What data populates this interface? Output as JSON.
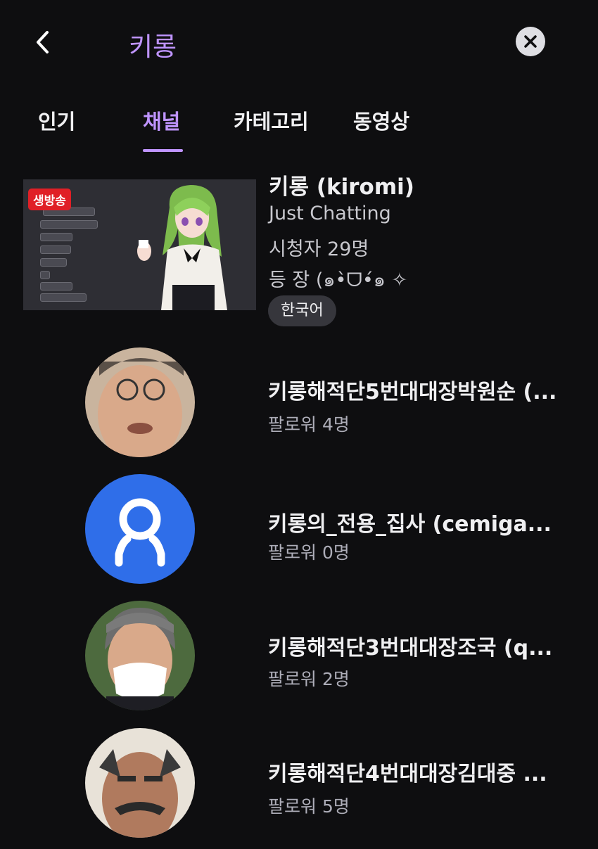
{
  "search": {
    "query": "키롱"
  },
  "tabs": [
    {
      "label": "인기"
    },
    {
      "label": "채널"
    },
    {
      "label": "카테고리"
    },
    {
      "label": "동영상"
    }
  ],
  "live": {
    "badge": "생방송",
    "title": "키롱 (kiromi)",
    "category": "Just Chatting",
    "viewers": "시청자 29명",
    "stream_title": "등 장 (๑•̀ᗜ•́๑ ✧",
    "tag": "한국어"
  },
  "channels": [
    {
      "name": "키롱해적단5번대대장박원순 (...",
      "followers": "팔로워 4명"
    },
    {
      "name": "키롱의_전용_집사 (cemiga...",
      "followers": "팔로워 0명"
    },
    {
      "name": "키롱해적단3번대대장조국 (q...",
      "followers": "팔로워 2명"
    },
    {
      "name": "키롱해적단4번대대장김대중 ...",
      "followers": "팔로워 5명"
    }
  ],
  "colors": {
    "accent": "#bf94ff",
    "background": "#0e0e10",
    "live_red": "#e01f26",
    "default_avatar": "#2f6ee9"
  },
  "icons": [
    "back-chevron-icon",
    "clear-icon",
    "default-user-icon"
  ]
}
